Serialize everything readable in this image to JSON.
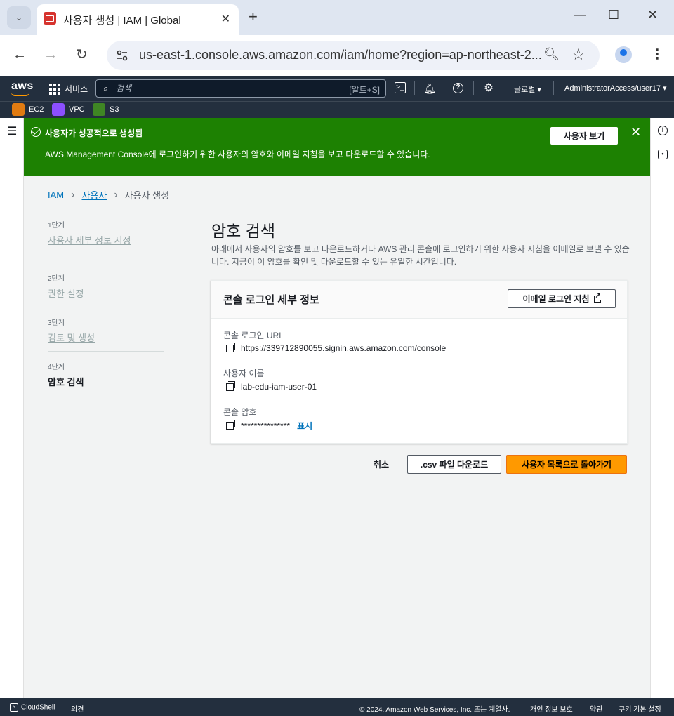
{
  "browser": {
    "tab_title": "사용자 생성 | IAM | Global",
    "url": "us-east-1.console.aws.amazon.com/iam/home?region=ap-northeast-2..."
  },
  "aws_header": {
    "logo": "aws",
    "services_label": "서비스",
    "search_placeholder": "검색",
    "search_shortcut": "[알트+S]",
    "region": "글로벌 ▾",
    "account": "AdministratorAccess/user17 ▾"
  },
  "favorites": [
    {
      "label": "EC2",
      "color": "#e07b12"
    },
    {
      "label": "VPC",
      "color": "#8c4fff"
    },
    {
      "label": "S3",
      "color": "#3f8624"
    }
  ],
  "flash": {
    "title": "사용자가 성공적으로 생성됨",
    "message": "AWS Management Console에 로그인하기 위한 사용자의 암호와 이메일 지침을 보고 다운로드할 수 있습니다.",
    "view_button": "사용자 보기",
    "color": "#1d8102"
  },
  "breadcrumb": {
    "items": [
      "IAM",
      "사용자",
      "사용자 생성"
    ]
  },
  "steps": [
    {
      "num": "1단계",
      "label": "사용자 세부 정보 지정"
    },
    {
      "num": "2단계",
      "label": "권한 설정"
    },
    {
      "num": "3단계",
      "label": "검토 및 생성"
    },
    {
      "num": "4단계",
      "label": "암호 검색"
    }
  ],
  "main": {
    "title": "암호 검색",
    "description": "아래에서 사용자의 암호를 보고 다운로드하거나 AWS 관리 콘솔에 로그인하기 위한 사용자 지침을 이메일로 보낼 수 있습니다. 지금이 이 암호를 확인 및 다운로드할 수 있는 유일한 시간입니다."
  },
  "panel": {
    "title": "콘솔 로그인 세부 정보",
    "email_button": "이메일 로그인 지침",
    "fields": [
      {
        "label": "콘솔 로그인 URL",
        "value": "https://339712890055.signin.aws.amazon.com/console"
      },
      {
        "label": "사용자 이름",
        "value": "lab-edu-iam-user-01"
      },
      {
        "label": "콘솔 암호",
        "value": "***************",
        "action": "표시"
      }
    ]
  },
  "actions": {
    "cancel": "취소",
    "csv": ".csv 파일 다운로드",
    "primary": "사용자 목록으로 돌아가기"
  },
  "bottom_bar": {
    "cloudshell": "CloudShell",
    "feedback": "의견",
    "copyright": "© 2024, Amazon Web Services, Inc. 또는 계열사.",
    "privacy": "개인 정보 보호",
    "terms": "약관",
    "cookies": "쿠키 기본 설정"
  }
}
